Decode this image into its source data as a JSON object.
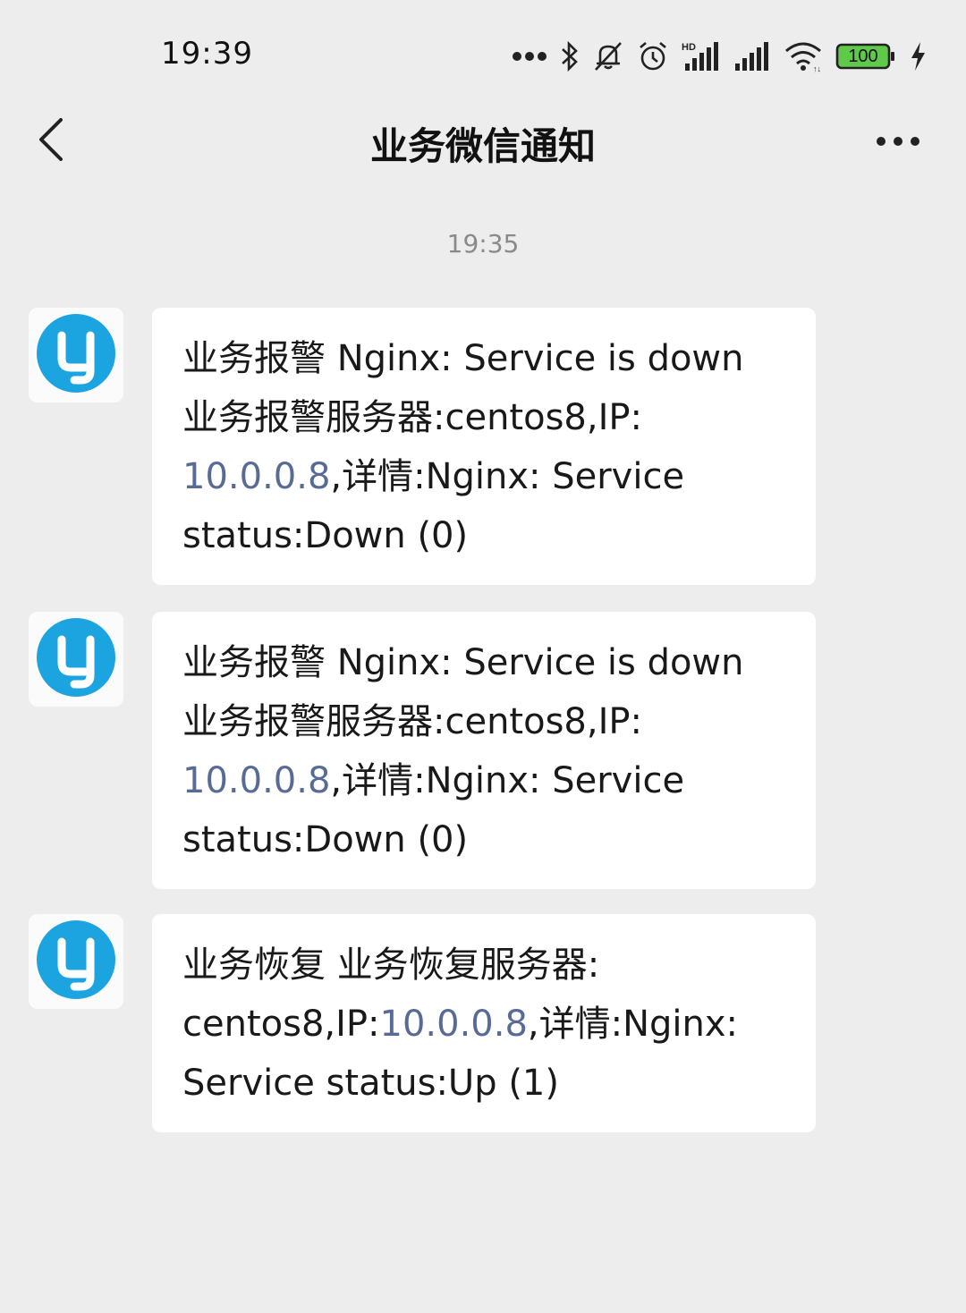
{
  "status_bar": {
    "time": "19:39",
    "battery_level": "100",
    "icons": [
      "more-dots-icon",
      "bluetooth-icon",
      "mute-icon",
      "alarm-icon",
      "hd-signal-icon",
      "signal-icon",
      "wifi-icon",
      "battery-icon",
      "charging-icon"
    ]
  },
  "header": {
    "title": "业务微信通知",
    "back_icon": "chevron-left-icon",
    "more_icon": "more-icon"
  },
  "chat": {
    "timestamp": "19:35",
    "messages": [
      {
        "avatar_icon": "app-logo-icon",
        "lines": [
          [
            {
              "text": "业务报警 Nginx: Service is down"
            }
          ],
          [
            {
              "text": "业务报警服务器:centos8,IP:"
            }
          ],
          [
            {
              "text": "10.0.0.8",
              "link": true
            },
            {
              "text": ",详情:Nginx: Service"
            }
          ],
          [
            {
              "text": "status:Down (0)"
            }
          ]
        ]
      },
      {
        "avatar_icon": "app-logo-icon",
        "lines": [
          [
            {
              "text": "业务报警 Nginx: Service is down"
            }
          ],
          [
            {
              "text": "业务报警服务器:centos8,IP:"
            }
          ],
          [
            {
              "text": "10.0.0.8",
              "link": true
            },
            {
              "text": ",详情:Nginx: Service"
            }
          ],
          [
            {
              "text": "status:Down (0)"
            }
          ]
        ]
      },
      {
        "avatar_icon": "app-logo-icon",
        "lines": [
          [
            {
              "text": "业务恢复 业务恢复服务器:"
            }
          ],
          [
            {
              "text": "centos8,IP:"
            },
            {
              "text": "10.0.0.8",
              "link": true
            },
            {
              "text": ",详情:Nginx:"
            }
          ],
          [
            {
              "text": "Service status:Up (1)"
            }
          ]
        ]
      }
    ]
  },
  "colors": {
    "background": "#ededed",
    "bubble": "#ffffff",
    "link": "#576b95",
    "logo": "#1ba4e0"
  }
}
